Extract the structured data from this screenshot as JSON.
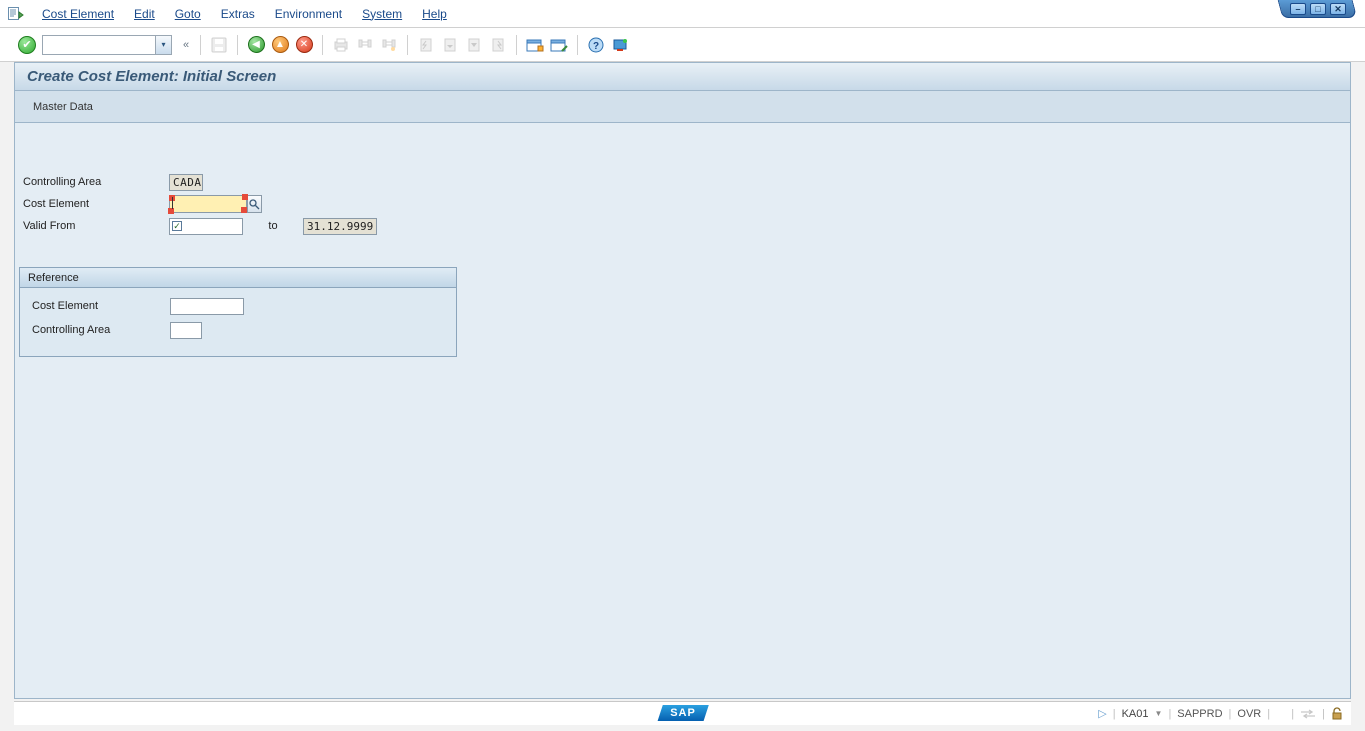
{
  "menu": {
    "items": [
      "Cost Element",
      "Edit",
      "Goto",
      "Extras",
      "Environment",
      "System",
      "Help"
    ],
    "first_letters": [
      "C",
      "E",
      "G",
      "",
      "",
      "S",
      "H"
    ]
  },
  "title": "Create Cost Element: Initial Screen",
  "app_toolbar": {
    "master_data": "Master Data"
  },
  "form": {
    "controlling_area_label": "Controlling Area",
    "controlling_area_value": "CADA",
    "cost_element_label": "Cost Element",
    "cost_element_value": "",
    "valid_from_label": "Valid From",
    "valid_to_label": "to",
    "valid_to_value": "31.12.9999"
  },
  "reference": {
    "title": "Reference",
    "cost_element_label": "Cost Element",
    "cost_element_value": "",
    "controlling_area_label": "Controlling Area",
    "controlling_area_value": ""
  },
  "status": {
    "tcode": "KA01",
    "system": "SAPPRD",
    "mode": "OVR",
    "sap": "SAP"
  }
}
